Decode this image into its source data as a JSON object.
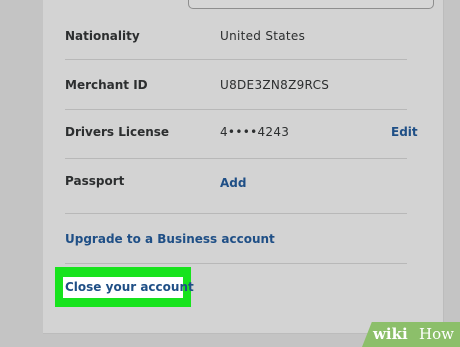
{
  "rows": [
    {
      "label": "Nationality",
      "value": "United States"
    },
    {
      "label": "Merchant ID",
      "value": "U8DE3ZN8Z9RCS"
    },
    {
      "label": "Drivers License",
      "value": "4••••4243",
      "action": "Edit"
    },
    {
      "label": "Passport",
      "action": "Add"
    }
  ],
  "upgrade_link": "Upgrade to a Business account",
  "close_account_link": "Close your account",
  "watermark": {
    "wiki": "wiki",
    "how": "How"
  },
  "colors": {
    "link": "#1f4f86",
    "highlight": "#17e31d",
    "background": "#c4c4c4"
  }
}
